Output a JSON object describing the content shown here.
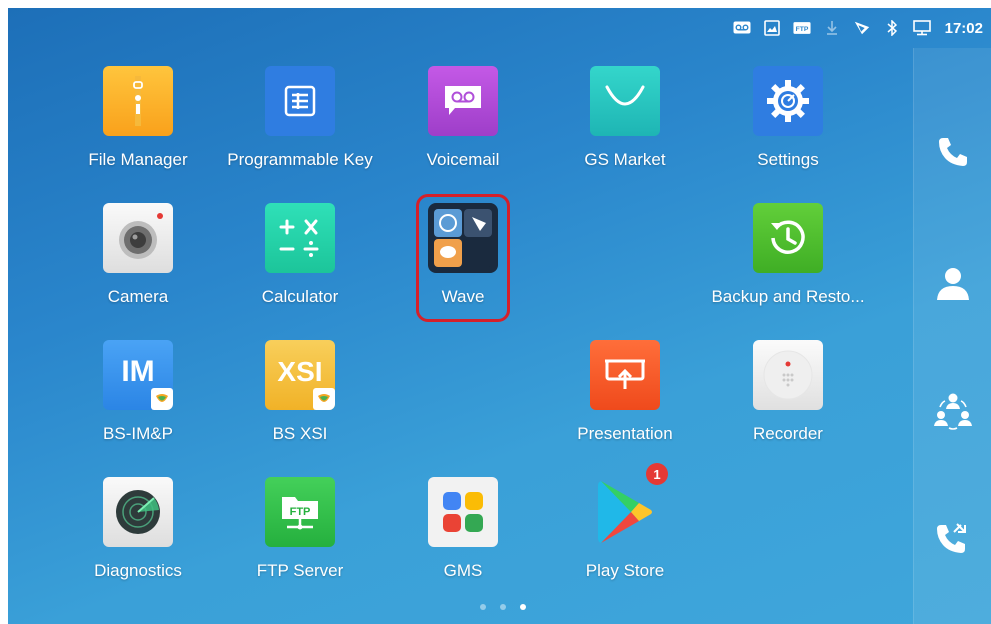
{
  "status_bar": {
    "time": "17:02",
    "icons": [
      "voicemail-icon",
      "screenshot-icon",
      "ftp-icon",
      "download-icon",
      "signal-icon",
      "bluetooth-icon",
      "display-icon"
    ],
    "ftp_text": "FTP"
  },
  "apps": [
    {
      "name": "file-manager",
      "label": "File Manager"
    },
    {
      "name": "programmable-key",
      "label": "Programmable Key"
    },
    {
      "name": "voicemail",
      "label": "Voicemail"
    },
    {
      "name": "gs-market",
      "label": "GS Market"
    },
    {
      "name": "settings",
      "label": "Settings"
    },
    {
      "name": "camera",
      "label": "Camera"
    },
    {
      "name": "calculator",
      "label": "Calculator"
    },
    {
      "name": "wave",
      "label": "Wave"
    },
    {
      "name": "backup-and-restore",
      "label": "Backup and Resto..."
    },
    {
      "name": "bs-im-p",
      "label": "BS-IM&P",
      "tile_text": "IM"
    },
    {
      "name": "bs-xsi",
      "label": "BS XSI",
      "tile_text": "XSI"
    },
    {
      "name": "presentation",
      "label": "Presentation"
    },
    {
      "name": "recorder",
      "label": "Recorder"
    },
    {
      "name": "diagnostics",
      "label": "Diagnostics"
    },
    {
      "name": "ftp-server",
      "label": "FTP Server",
      "tile_text": "FTP"
    },
    {
      "name": "gms",
      "label": "GMS"
    },
    {
      "name": "play-store",
      "label": "Play Store",
      "badge": "1"
    }
  ],
  "dock": [
    "phone-icon",
    "contacts-icon",
    "conference-icon",
    "call-history-icon"
  ],
  "page_indicator": {
    "count": 3,
    "active": 2
  },
  "colors": {
    "highlight": "#d5202a",
    "background": "#2a86cc"
  }
}
